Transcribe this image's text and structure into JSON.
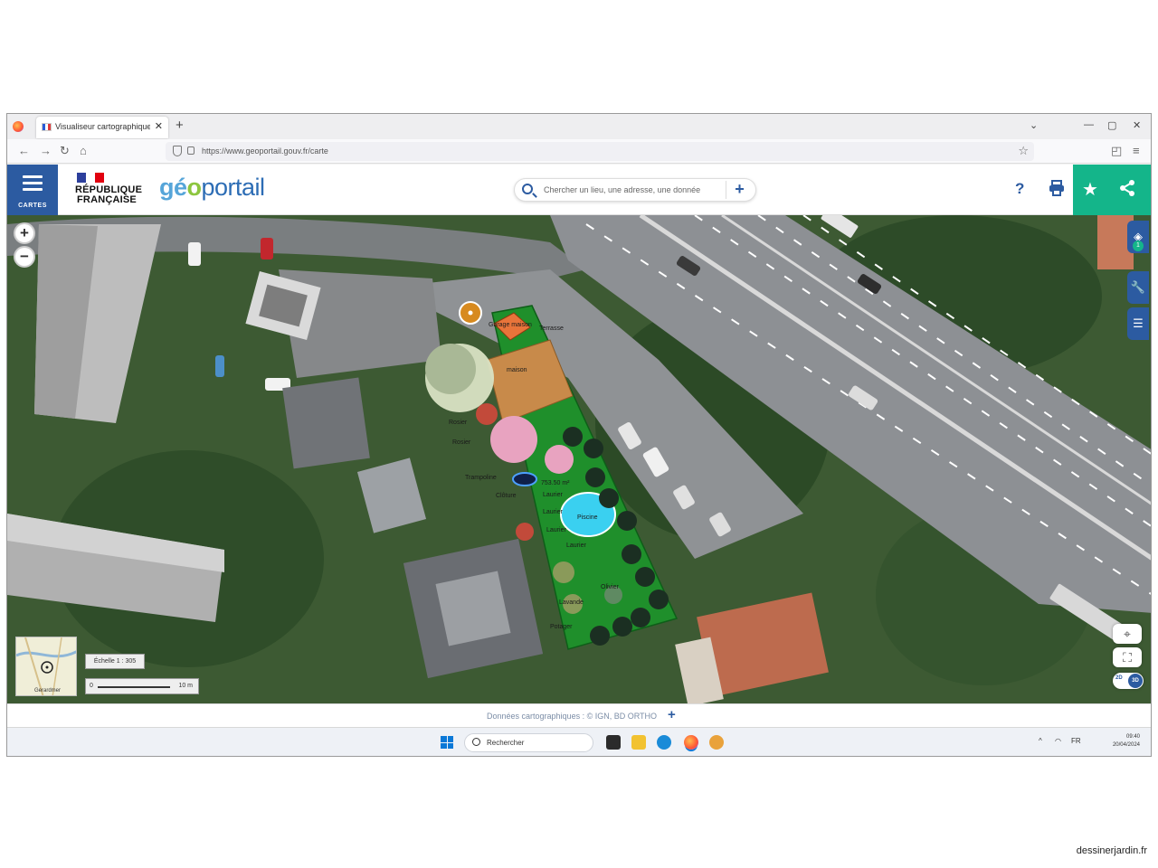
{
  "browser": {
    "tab_title": "Visualiseur cartographique – Géoportail",
    "tab_close": "✕",
    "new_tab": "+",
    "url": "https://www.geoportail.gouv.fr/carte",
    "window_controls": [
      "⌄",
      "—",
      "▢",
      "✕"
    ]
  },
  "header": {
    "cartes_label": "CARTES",
    "republique_line1": "RÉPUBLIQUE",
    "republique_line2": "FRANÇAISE",
    "logo_part1": "gé",
    "logo_part2": "o",
    "logo_part3": "portail",
    "search_placeholder": "Chercher un lieu, une adresse, une donnée",
    "search_plus": "+",
    "help": "?",
    "print_icon": "print-icon",
    "favorite_icon": "star-icon",
    "share_icon": "share-icon"
  },
  "map": {
    "zoom_in": "+",
    "zoom_out": "−",
    "right_tools": [
      "layers-icon",
      "wrench-icon",
      "list-icon"
    ],
    "layers_badge": "1",
    "scale_text": "Échelle 1 : 305",
    "scalebar_zero": "0",
    "scalebar_distance": "10 m",
    "minimap_label": "Gerardmer",
    "dim_2d": "2D",
    "dim_3d": "3D",
    "plan_labels": [
      {
        "text": "Garage maison"
      },
      {
        "text": "Terrasse"
      },
      {
        "text": "maison"
      },
      {
        "text": "Rosier"
      },
      {
        "text": "Rosier"
      },
      {
        "text": "Trampoline"
      },
      {
        "text": "753.50 m²"
      },
      {
        "text": "Clôture"
      },
      {
        "text": "Laurier"
      },
      {
        "text": "Laurier"
      },
      {
        "text": "Piscine"
      },
      {
        "text": "Laurier"
      },
      {
        "text": "Laurier"
      },
      {
        "text": "Olivier"
      },
      {
        "text": "Lavande"
      },
      {
        "text": "Potager"
      }
    ]
  },
  "footer": {
    "attribution": "Données cartographiques : © IGN, BD ORTHO",
    "attribution_plus": "+"
  },
  "taskbar": {
    "search_text": "Rechercher",
    "tray_chevron": "^",
    "tray_lang": "FR",
    "time": "09:40",
    "date": "20/04/2024"
  },
  "watermark": "dessinerjardin.fr",
  "colors": {
    "gp_blue": "#2c5ba1",
    "gp_green": "#14b58a",
    "lawn": "#1f8f2b",
    "house": "#c88a4a",
    "pool": "#3ad0f0"
  }
}
